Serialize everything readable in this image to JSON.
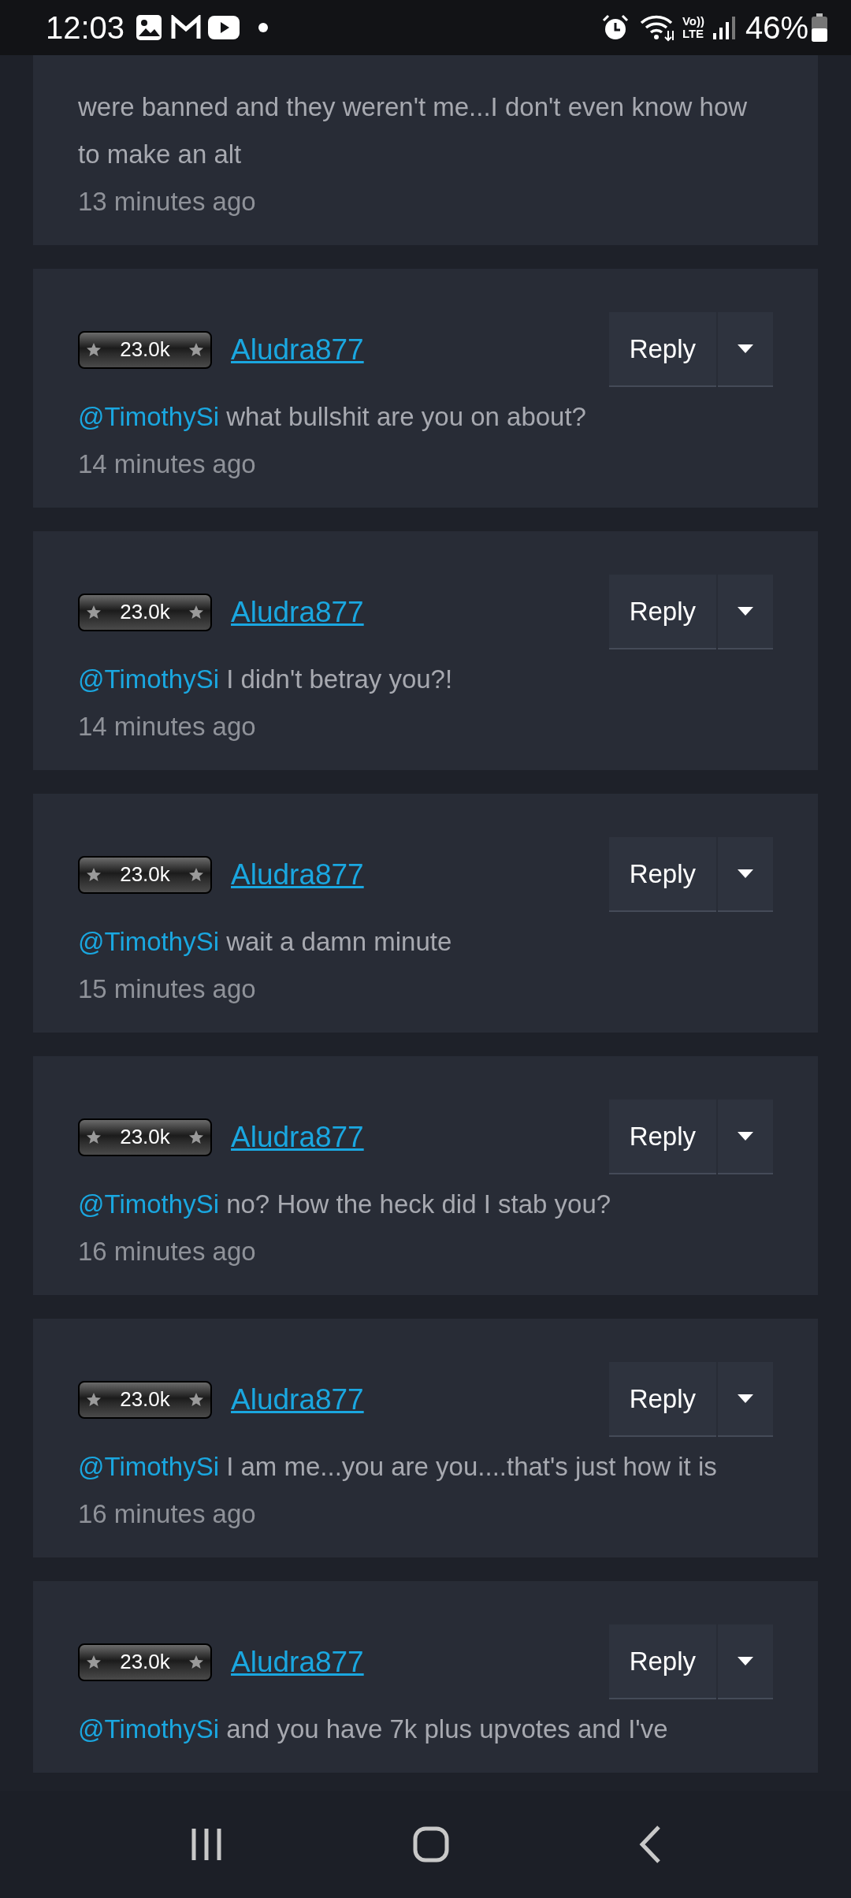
{
  "status_bar": {
    "time": "12:03",
    "volte_top": "Vo))",
    "volte_bottom": "LTE",
    "battery": "46%"
  },
  "comments": [
    {
      "kind": "partial",
      "text": "were banned and they weren't me...I don't even know how to make an alt",
      "time": "13 minutes ago"
    },
    {
      "kind": "full",
      "badge": "23.0k",
      "username": "Aludra877",
      "mention": "@TimothySi",
      "text": "what bullshit are you on about?",
      "time": "14 minutes ago",
      "reply": "Reply"
    },
    {
      "kind": "full",
      "badge": "23.0k",
      "username": "Aludra877",
      "mention": "@TimothySi",
      "text": "I didn't betray you?!",
      "time": "14 minutes ago",
      "reply": "Reply"
    },
    {
      "kind": "full",
      "badge": "23.0k",
      "username": "Aludra877",
      "mention": "@TimothySi",
      "text": "wait a damn minute",
      "time": "15 minutes ago",
      "reply": "Reply"
    },
    {
      "kind": "full",
      "badge": "23.0k",
      "username": "Aludra877",
      "mention": "@TimothySi",
      "text": "no? How the heck did I stab you?",
      "time": "16 minutes ago",
      "reply": "Reply"
    },
    {
      "kind": "full",
      "badge": "23.0k",
      "username": "Aludra877",
      "mention": "@TimothySi",
      "text": "I am me...you are you....that's just how it is",
      "time": "16 minutes ago",
      "reply": "Reply"
    },
    {
      "kind": "full",
      "badge": "23.0k",
      "username": "Aludra877",
      "mention": "@TimothySi",
      "text": "and you have 7k plus upvotes and I've",
      "reply": "Reply"
    }
  ]
}
